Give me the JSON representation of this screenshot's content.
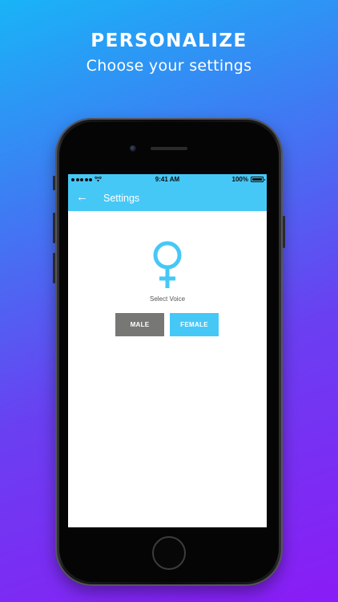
{
  "promo": {
    "headline": "PERSONALIZE",
    "subline": "Choose your settings"
  },
  "status_bar": {
    "carrier_signal_icon": "signal-dots-icon",
    "wifi_icon": "wifi-icon",
    "time": "9:41 AM",
    "battery": "100%",
    "battery_icon": "battery-icon"
  },
  "app_bar": {
    "back_icon": "arrow-left-icon",
    "title": "Settings",
    "color": "#46c8f7"
  },
  "voice": {
    "icon": "female-symbol-icon",
    "label": "Select Voice",
    "options": [
      "MALE",
      "FEMALE"
    ],
    "selected": "FEMALE",
    "male_color": "#777775",
    "female_color": "#46c8f7"
  },
  "waveform": {
    "icon": "sound-wave-icon",
    "gradient": [
      "#8a5cf0",
      "#b37cf3",
      "#39c8f5"
    ]
  }
}
